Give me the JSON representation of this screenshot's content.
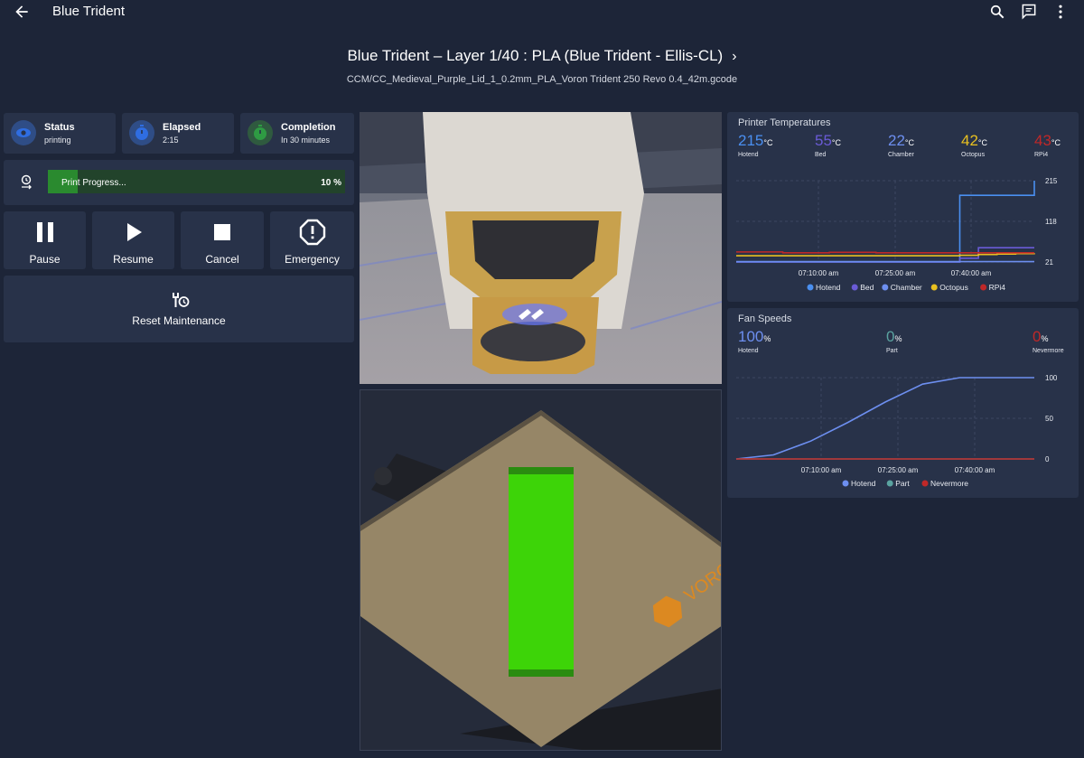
{
  "app": {
    "title": "Blue Trident"
  },
  "header": {
    "job_title": "Blue Trident – Layer 1/40 : PLA (Blue Trident - Ellis-CL)",
    "file_name": "CCM/CC_Medieval_Purple_Lid_1_0.2mm_PLA_Voron Trident 250 Revo 0.4_42m.gcode"
  },
  "stats": {
    "status": {
      "label": "Status",
      "value": "printing",
      "color": "#2f6de1"
    },
    "elapsed": {
      "label": "Elapsed",
      "value": "2:15",
      "color": "#2f6de1"
    },
    "completion": {
      "label": "Completion",
      "value": "In 30 minutes",
      "color": "#2e9b43"
    }
  },
  "progress": {
    "label": "Print Progress...",
    "percent_text": "10 %",
    "fraction": 0.1
  },
  "controls": {
    "pause": "Pause",
    "resume": "Resume",
    "cancel": "Cancel",
    "emergency": "Emergency",
    "reset": "Reset Maintenance"
  },
  "icons": [
    "back-arrow-icon",
    "search-icon",
    "chat-icon",
    "more-vert-icon",
    "eye-icon",
    "stopwatch-icon",
    "timer-icon",
    "progress-icon",
    "pause-icon",
    "play-icon",
    "stop-icon",
    "alert-octagon-icon",
    "wrench-clock-icon"
  ],
  "temps_card": {
    "title": "Printer Temperatures",
    "readouts": [
      {
        "value": "215",
        "unit": "°C",
        "name": "Hotend",
        "color": "#4a8ff0"
      },
      {
        "value": "55",
        "unit": "°C",
        "name": "Bed",
        "color": "#6a5bd6"
      },
      {
        "value": "22",
        "unit": "°C",
        "name": "Chamber",
        "color": "#6d8ff0"
      },
      {
        "value": "42",
        "unit": "°C",
        "name": "Octopus",
        "color": "#e8c020"
      },
      {
        "value": "43",
        "unit": "°C",
        "name": "RPi4",
        "color": "#c02828"
      }
    ]
  },
  "fans_card": {
    "title": "Fan Speeds",
    "readouts": [
      {
        "value": "100",
        "unit": "%",
        "name": "Hotend",
        "color": "#6d8ff0"
      },
      {
        "value": "0",
        "unit": "%",
        "name": "Part",
        "color": "#5aa3a0"
      },
      {
        "value": "0",
        "unit": "%",
        "name": "Nevermore",
        "color": "#c02828"
      }
    ]
  },
  "chart_data": [
    {
      "type": "line",
      "title": "Printer Temperatures",
      "x_ticks": [
        "07:10:00 am",
        "07:25:00 am",
        "07:40:00 am"
      ],
      "x": [
        0,
        5,
        10,
        15,
        20,
        22,
        24,
        26,
        28,
        30,
        32
      ],
      "y_ticks": [
        21,
        118,
        215
      ],
      "ylim": [
        21,
        215
      ],
      "legend": "bottom",
      "series": [
        {
          "name": "Hotend",
          "color": "#4a8ff0",
          "values": [
            21,
            21,
            21,
            21,
            21,
            21,
            180,
            180,
            180,
            180,
            215
          ]
        },
        {
          "name": "Bed",
          "color": "#6a5bd6",
          "values": [
            21,
            21,
            21,
            21,
            21,
            21,
            30,
            55,
            55,
            55,
            55
          ]
        },
        {
          "name": "Chamber",
          "color": "#6d8ff0",
          "values": [
            22,
            22,
            22,
            22,
            22,
            22,
            22,
            22,
            22,
            22,
            22
          ]
        },
        {
          "name": "Octopus",
          "color": "#e8c020",
          "values": [
            36,
            36,
            36,
            36,
            36,
            36,
            37,
            39,
            40,
            41,
            42
          ]
        },
        {
          "name": "RPi4",
          "color": "#c02828",
          "values": [
            45,
            43,
            44,
            43,
            43,
            43,
            43,
            43,
            43,
            43,
            43
          ]
        }
      ]
    },
    {
      "type": "line",
      "title": "Fan Speeds",
      "x_ticks": [
        "07:10:00 am",
        "07:25:00 am",
        "07:40:00 am"
      ],
      "x": [
        0,
        4,
        8,
        12,
        16,
        20,
        24,
        28,
        32
      ],
      "y_ticks": [
        0,
        50,
        100
      ],
      "ylim": [
        0,
        100
      ],
      "legend": "bottom",
      "series": [
        {
          "name": "Hotend",
          "color": "#6d8ff0",
          "values": [
            0,
            5,
            22,
            45,
            70,
            92,
            100,
            100,
            100
          ]
        },
        {
          "name": "Part",
          "color": "#5aa3a0",
          "values": [
            0,
            0,
            0,
            0,
            0,
            0,
            0,
            0,
            0
          ]
        },
        {
          "name": "Nevermore",
          "color": "#c02828",
          "values": [
            0,
            0,
            0,
            0,
            0,
            0,
            0,
            0,
            0
          ]
        }
      ]
    }
  ]
}
